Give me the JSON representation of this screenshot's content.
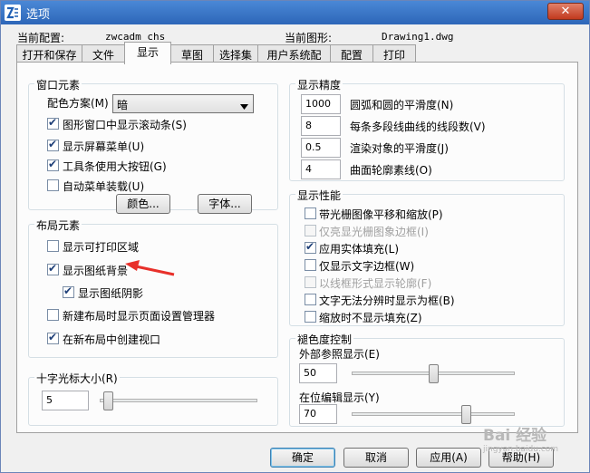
{
  "window": {
    "title": "选项",
    "close_symbol": "✕"
  },
  "profile": {
    "current_config_label": "当前配置:",
    "current_config_value": "zwcadm_chs",
    "current_drawing_label": "当前图形:",
    "current_drawing_value": "Drawing1.dwg"
  },
  "tabs": [
    "打开和保存",
    "文件",
    "显示",
    "草图",
    "选择集",
    "用户系统配置",
    "配置",
    "打印"
  ],
  "window_elements": {
    "title": "窗口元素",
    "color_scheme_label": "配色方案(M)",
    "color_scheme_value": "暗",
    "checkboxes": [
      {
        "label": "图形窗口中显示滚动条(S)",
        "checked": true
      },
      {
        "label": "显示屏幕菜单(U)",
        "checked": true
      },
      {
        "label": "工具条使用大按钮(G)",
        "checked": true
      },
      {
        "label": "自动菜单装载(U)",
        "checked": false
      }
    ],
    "colors_button": "颜色...",
    "fonts_button": "字体..."
  },
  "layout_elements": {
    "title": "布局元素",
    "checkboxes": [
      {
        "label": "显示可打印区域",
        "checked": false
      },
      {
        "label": "显示图纸背景",
        "checked": true
      },
      {
        "label": "显示图纸阴影",
        "checked": true
      },
      {
        "label": "新建布局时显示页面设置管理器",
        "checked": false
      },
      {
        "label": "在新布局中创建视口",
        "checked": true
      }
    ]
  },
  "crosshair": {
    "title": "十字光标大小(R)",
    "value": "5",
    "slider_fraction": 0.05
  },
  "display_resolution": {
    "title": "显示精度",
    "rows": [
      {
        "value": "1000",
        "label": "圆弧和圆的平滑度(N)"
      },
      {
        "value": "8",
        "label": "每条多段线曲线的线段数(V)"
      },
      {
        "value": "0.5",
        "label": "渲染对象的平滑度(J)"
      },
      {
        "value": "4",
        "label": "曲面轮廓素线(O)"
      }
    ]
  },
  "display_performance": {
    "title": "显示性能",
    "checkboxes": [
      {
        "label": "带光栅图像平移和缩放(P)",
        "checked": false,
        "disabled": false
      },
      {
        "label": "仅亮显光栅图象边框(I)",
        "checked": false,
        "disabled": true
      },
      {
        "label": "应用实体填充(L)",
        "checked": true,
        "disabled": false
      },
      {
        "label": "仅显示文字边框(W)",
        "checked": false,
        "disabled": false
      },
      {
        "label": "以线框形式显示轮廓(F)",
        "checked": false,
        "disabled": true
      },
      {
        "label": "文字无法分辨时显示为框(B)",
        "checked": false,
        "disabled": false
      },
      {
        "label": "缩放时不显示填充(Z)",
        "checked": false,
        "disabled": false
      }
    ]
  },
  "fade_control": {
    "title": "褪色度控制",
    "xref_label": "外部参照显示(E)",
    "xref_value": "50",
    "xref_fraction": 0.5,
    "inplace_label": "在位编辑显示(Y)",
    "inplace_value": "70",
    "inplace_fraction": 0.7
  },
  "buttons": {
    "ok": "确定",
    "cancel": "取消",
    "apply": "应用(A)",
    "help": "帮助(H)"
  },
  "annotation": {
    "arrow_color": "#e8302a"
  },
  "watermark": {
    "text": "Bai 经验",
    "subtext": "jingyan.baidu.com"
  }
}
